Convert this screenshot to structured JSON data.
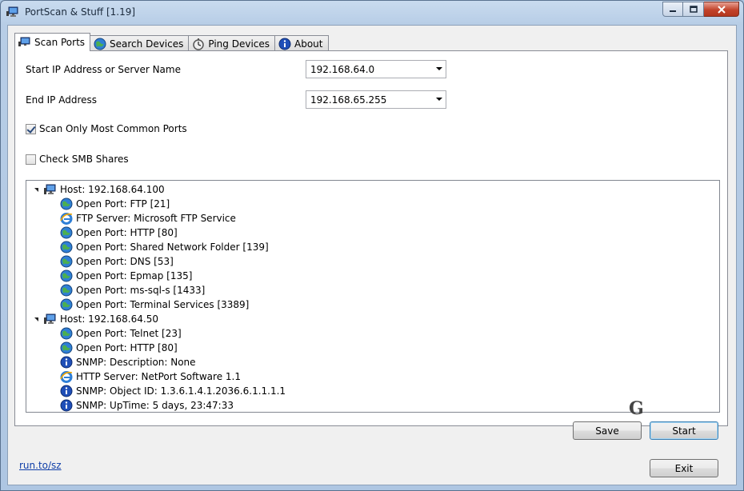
{
  "window": {
    "title": "PortScan & Stuff [1.19]"
  },
  "tabs": [
    {
      "label": "Scan Ports",
      "icon": "network-monitor-icon",
      "active": true
    },
    {
      "label": "Search Devices",
      "icon": "globe-icon",
      "active": false
    },
    {
      "label": "Ping Devices",
      "icon": "stopwatch-icon",
      "active": false
    },
    {
      "label": "About",
      "icon": "info-icon",
      "active": false
    }
  ],
  "form": {
    "start_ip_label": "Start IP Address or Server Name",
    "start_ip_value": "192.168.64.0",
    "end_ip_label": "End IP Address",
    "end_ip_value": "192.168.65.255",
    "common_ports_label": "Scan Only Most Common Ports",
    "common_ports_checked": true,
    "smb_label": "Check SMB Shares",
    "smb_checked": false
  },
  "results": [
    {
      "label": "Host: 192.168.64.100",
      "icon": "host-computer-icon",
      "level": 0,
      "children": [
        {
          "label": "Open Port: FTP [21]",
          "icon": "globe-icon"
        },
        {
          "label": "FTP Server: Microsoft FTP Service",
          "icon": "ie-icon"
        },
        {
          "label": "Open Port: HTTP [80]",
          "icon": "globe-icon"
        },
        {
          "label": "Open Port: Shared Network Folder [139]",
          "icon": "globe-icon"
        },
        {
          "label": "Open Port: DNS [53]",
          "icon": "globe-icon"
        },
        {
          "label": "Open Port: Epmap [135]",
          "icon": "globe-icon"
        },
        {
          "label": "Open Port: ms-sql-s [1433]",
          "icon": "globe-icon"
        },
        {
          "label": "Open Port: Terminal Services [3389]",
          "icon": "globe-icon"
        }
      ]
    },
    {
      "label": "Host: 192.168.64.50",
      "icon": "host-computer-icon",
      "level": 0,
      "children": [
        {
          "label": "Open Port: Telnet [23]",
          "icon": "globe-icon"
        },
        {
          "label": "Open Port: HTTP [80]",
          "icon": "globe-icon"
        },
        {
          "label": "SNMP: Description: None",
          "icon": "info-icon"
        },
        {
          "label": "HTTP Server: NetPort Software 1.1",
          "icon": "ie-icon"
        },
        {
          "label": "SNMP: Object ID: 1.3.6.1.4.1.2036.6.1.1.1.1",
          "icon": "info-icon"
        },
        {
          "label": "SNMP: UpTime: 5 days, 23:47:33",
          "icon": "info-icon"
        }
      ]
    }
  ],
  "watermark": "G",
  "buttons": {
    "save": "Save",
    "start": "Start",
    "exit": "Exit"
  },
  "footer": {
    "link": "run.to/sz"
  },
  "colors": {
    "link": "#0f3ea8",
    "close_button": "#c2432b",
    "default_button_border": "#3c7fb1"
  }
}
